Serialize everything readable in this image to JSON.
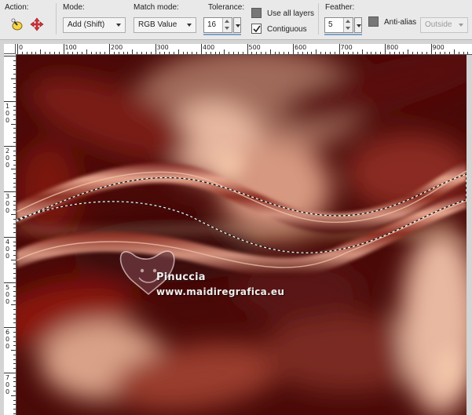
{
  "toolbar": {
    "action_label": "Action:",
    "mode_label": "Mode:",
    "mode_value": "Add (Shift)",
    "match_mode_label": "Match mode:",
    "match_mode_value": "RGB Value",
    "tolerance_label": "Tolerance:",
    "tolerance_value": "16",
    "use_all_layers_label": "Use all layers",
    "use_all_layers_checked": false,
    "contiguous_label": "Contiguous",
    "contiguous_checked": true,
    "feather_label": "Feather:",
    "feather_value": "5",
    "anti_alias_label": "Anti-alias",
    "anti_alias_checked": false,
    "anti_alias_side_value": "Outside"
  },
  "ruler": {
    "top_labels": [
      "0",
      "100",
      "200",
      "300",
      "400",
      "500",
      "600",
      "700",
      "800",
      "900"
    ],
    "left_labels": [
      "1\n0\n0",
      "2\n0\n0",
      "3\n0\n0",
      "4\n0\n0",
      "5\n0\n0",
      "6\n0\n0",
      "7\n0\n0"
    ]
  },
  "watermark": {
    "name": "Pinuccia",
    "url": "www.maidiregrafica.eu"
  },
  "colors": {
    "toolbar_bg": "#e9e9e9",
    "canvas_dark": "#4a0a08",
    "canvas_light": "#e8b49a",
    "selection": "#ffffff"
  }
}
